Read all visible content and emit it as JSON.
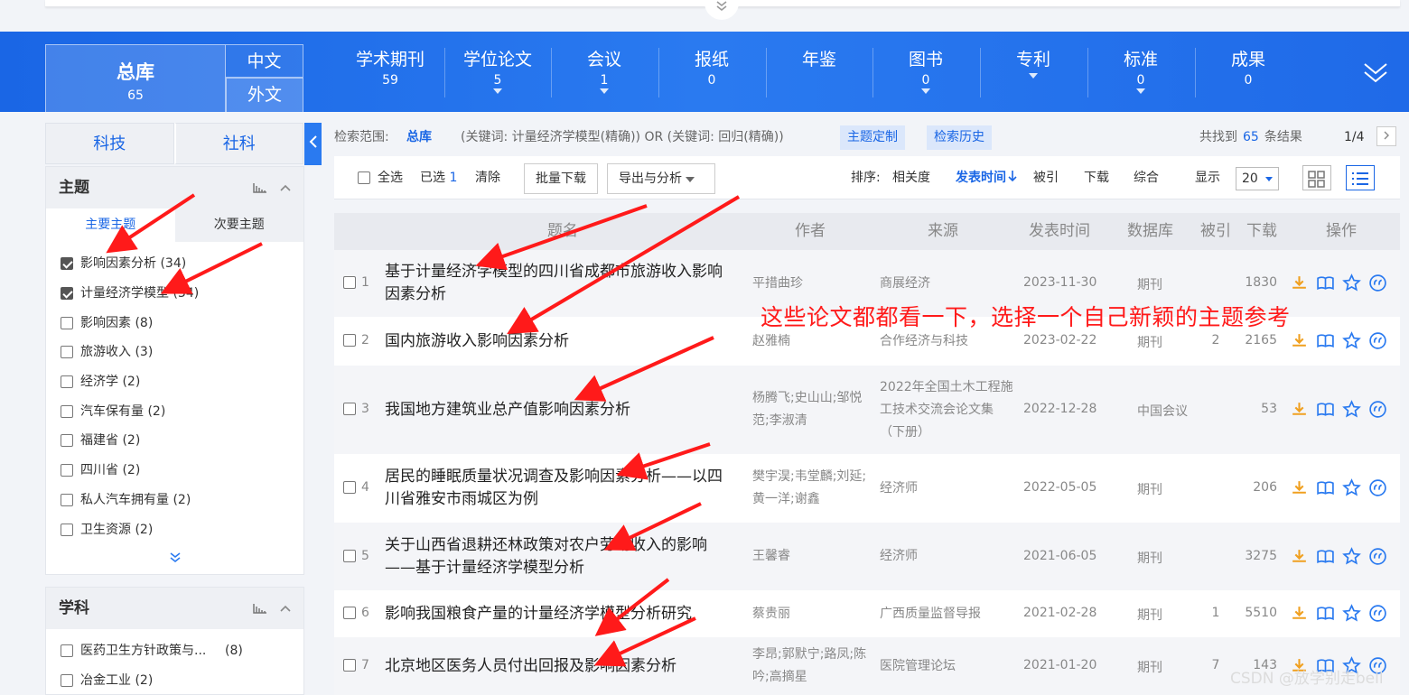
{
  "nav": {
    "zongku": {
      "label": "总库",
      "count": "65"
    },
    "lang_zh": "中文",
    "lang_wai": "外文",
    "items": [
      {
        "label": "学术期刊",
        "count": "59",
        "dot": false
      },
      {
        "label": "学位论文",
        "count": "5",
        "dot": true
      },
      {
        "label": "会议",
        "count": "1",
        "dot": true
      },
      {
        "label": "报纸",
        "count": "0",
        "dot": false
      },
      {
        "label": "年鉴",
        "count": "",
        "dot": false
      },
      {
        "label": "图书",
        "count": "0",
        "dot": true
      },
      {
        "label": "专利",
        "count": "",
        "dot": true
      },
      {
        "label": "标准",
        "count": "0",
        "dot": true
      },
      {
        "label": "成果",
        "count": "0",
        "dot": false
      }
    ]
  },
  "sidebar": {
    "tabs": [
      "科技",
      "社科"
    ],
    "theme": {
      "title": "主题",
      "subtabs": [
        "主要主题",
        "次要主题"
      ],
      "facets": [
        {
          "label": "影响因素分析 (34)",
          "checked": true
        },
        {
          "label": "计量经济学模型 (34)",
          "checked": true
        },
        {
          "label": "影响因素 (8)",
          "checked": false
        },
        {
          "label": "旅游收入 (3)",
          "checked": false
        },
        {
          "label": "经济学 (2)",
          "checked": false
        },
        {
          "label": "汽车保有量 (2)",
          "checked": false
        },
        {
          "label": "福建省 (2)",
          "checked": false
        },
        {
          "label": "四川省 (2)",
          "checked": false
        },
        {
          "label": "私人汽车拥有量 (2)",
          "checked": false
        },
        {
          "label": "卫生资源 (2)",
          "checked": false
        }
      ]
    },
    "subject": {
      "title": "学科",
      "facets": [
        {
          "label": "医药卫生方针政策与...",
          "count": "(8)"
        },
        {
          "label": "冶金工业 (2)",
          "count": ""
        }
      ]
    }
  },
  "scope": {
    "label": "检索范围:",
    "lib": "总库",
    "expr": "(关键词: 计量经济学模型(精确)) OR (关键词: 回归(精确))",
    "btn_custom": "主题定制",
    "btn_history": "检索历史",
    "found_pre": "共找到",
    "found_num": "65",
    "found_post": "条结果",
    "page": "1/4"
  },
  "toolbar": {
    "select_all": "全选",
    "selected_label": "已选",
    "selected_count": "1",
    "clear": "清除",
    "batch_download": "批量下载",
    "export": "导出与分析",
    "sort_label": "排序:",
    "sort_relevance": "相关度",
    "sort_date": "发表时间",
    "sort_cite": "被引",
    "sort_download": "下载",
    "sort_overall": "综合",
    "show_label": "显示",
    "page_size": "20"
  },
  "table": {
    "headers": [
      "题名",
      "作者",
      "来源",
      "发表时间",
      "数据库",
      "被引",
      "下载",
      "操作"
    ],
    "rows": [
      {
        "num": "1",
        "title": "基于计量经济学模型的四川省成都市旅游收入影响因素分析",
        "author": "平措曲珍",
        "source": "商展经济",
        "date": "2023-11-30",
        "db": "期刊",
        "cite": "",
        "download": "1830"
      },
      {
        "num": "2",
        "title": "国内旅游收入影响因素分析",
        "author": "赵雅楠",
        "source": "合作经济与科技",
        "date": "2023-02-22",
        "db": "期刊",
        "cite": "2",
        "download": "2165"
      },
      {
        "num": "3",
        "title": "我国地方建筑业总产值影响因素分析",
        "author": "杨腾飞;史山山;邹悦范;李淑清",
        "source": "2022年全国土木工程施工技术交流会论文集（下册）",
        "date": "2022-12-28",
        "db": "中国会议",
        "cite": "",
        "download": "53"
      },
      {
        "num": "4",
        "title": "居民的睡眠质量状况调查及影响因素分析——以四川省雅安市雨城区为例",
        "author": "樊宇淏;韦堂麟;刘延;黄一洋;谢鑫",
        "source": "经济师",
        "date": "2022-05-05",
        "db": "期刊",
        "cite": "",
        "download": "206"
      },
      {
        "num": "5",
        "title": "关于山西省退耕还林政策对农户劳动收入的影响——基于计量经济学模型分析",
        "author": "王馨睿",
        "source": "经济师",
        "date": "2021-06-05",
        "db": "期刊",
        "cite": "",
        "download": "3275"
      },
      {
        "num": "6",
        "title": "影响我国粮食产量的计量经济学模型分析研究",
        "author": "蔡贵丽",
        "source": "广西质量监督导报",
        "date": "2021-02-28",
        "db": "期刊",
        "cite": "1",
        "download": "5510"
      },
      {
        "num": "7",
        "title": "北京地区医务人员付出回报及影响因素分析",
        "author": "李昂;郭默宁;路凤;陈吟;高摘星",
        "source": "医院管理论坛",
        "date": "2021-01-20",
        "db": "期刊",
        "cite": "7",
        "download": "143"
      }
    ]
  },
  "annotation": "这些论文都都看一下，选择一个自己新颖的主题参考",
  "watermark": "CSDN @放学别走bell",
  "colors": {
    "brand_blue": "#1a66e5",
    "annotation_red": "#ff1a1a",
    "download_orange": "#f0a020"
  }
}
